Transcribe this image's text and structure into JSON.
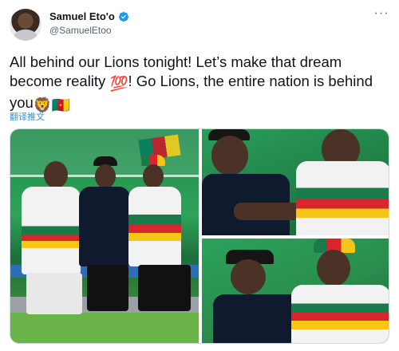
{
  "author": {
    "display_name": "Samuel Eto'o",
    "handle": "@SamuelEtoo",
    "verified": true,
    "avatar_icon": "profile-avatar"
  },
  "tweet": {
    "text_part1": "All behind our Lions tonight! Let’s make that dream become reality ",
    "emoji_100": "💯",
    "text_part2": "! Go Lions, the entire nation is behind you",
    "emoji_lion": "🦁",
    "emoji_flag": "🇨🇲",
    "translate_label": "翻译推文"
  },
  "menu": {
    "more_label": "···"
  },
  "colors": {
    "link": "#1d9bf0",
    "text": "#0f1419",
    "muted": "#536471",
    "verified": "#1d9bf0"
  },
  "media": {
    "photos": [
      {
        "description_icon": "photo-bench-group"
      },
      {
        "description_icon": "photo-two-men-closeup"
      },
      {
        "description_icon": "photo-two-men-watching"
      }
    ]
  }
}
